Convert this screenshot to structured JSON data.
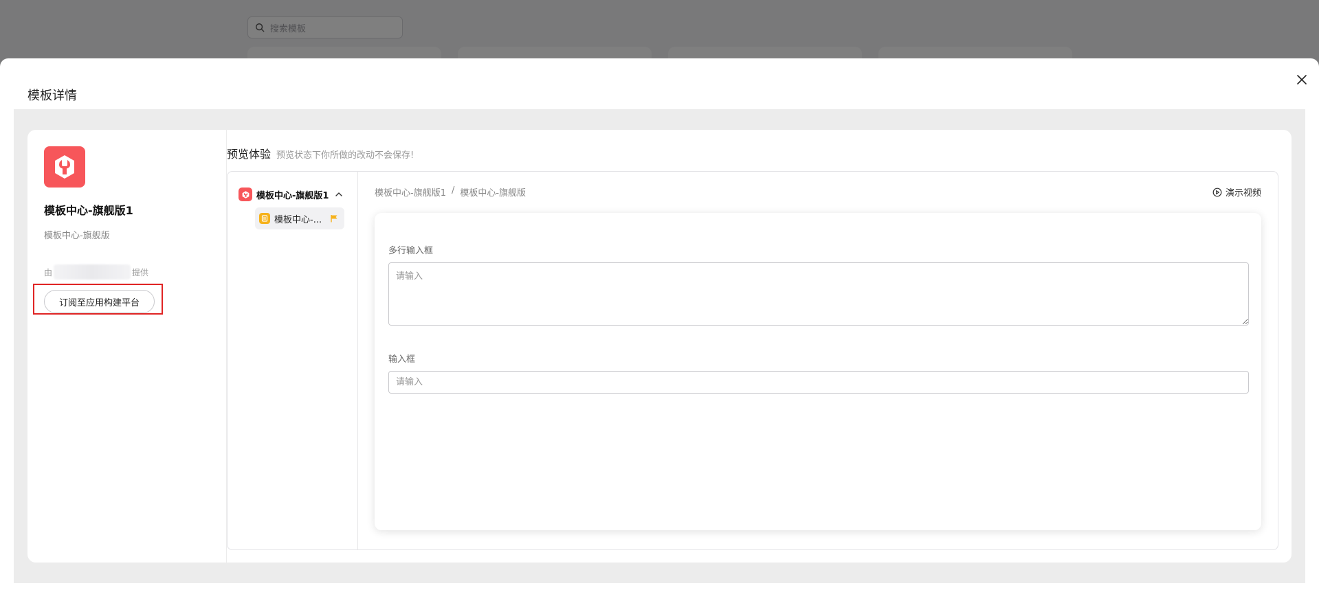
{
  "background": {
    "search_placeholder": "搜索模板"
  },
  "modal": {
    "title": "模板详情"
  },
  "app": {
    "name": "模板中心-旗舰版1",
    "description": "模板中心-旗舰版",
    "provider_prefix": "由",
    "provider_suffix": "提供",
    "subscribe_label": "订阅至应用构建平台"
  },
  "preview": {
    "title": "预览体验",
    "note": "预览状态下你所做的改动不会保存!",
    "tree": {
      "root_label": "模板中心-旗舰版1",
      "child_label": "模板中心-..."
    },
    "breadcrumb": [
      "模板中心-旗舰版1",
      "/",
      "模板中心-旗舰版"
    ],
    "demo_video_label": "演示视频",
    "form": {
      "multiline_label": "多行输入框",
      "multiline_placeholder": "请输入",
      "input_label": "输入框",
      "input_placeholder": "请输入"
    }
  },
  "colors": {
    "brand_red": "#f7565a",
    "page_orange": "#f6b21b",
    "highlight_red": "#e02424"
  },
  "icons": {
    "app": "wrench-icon",
    "close": "close-icon",
    "search": "search-icon",
    "play": "play-circle-icon",
    "chevron": "chevron-up-icon",
    "flag": "flag-icon"
  }
}
